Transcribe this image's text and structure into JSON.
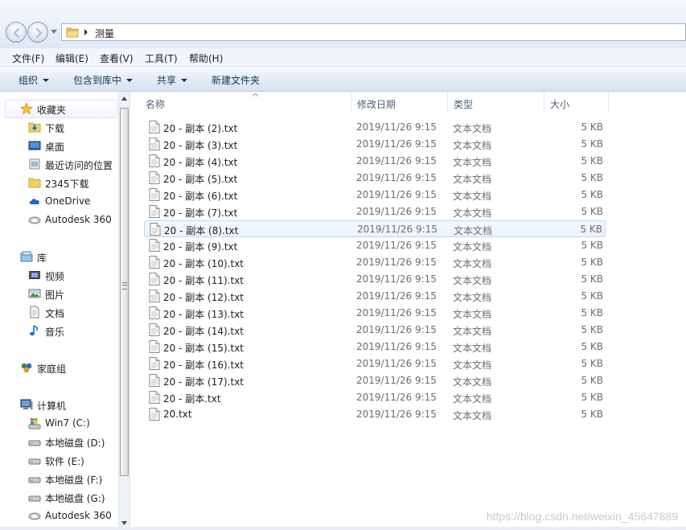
{
  "address": {
    "path": "测量"
  },
  "menu": [
    "文件(F)",
    "编辑(E)",
    "查看(V)",
    "工具(T)",
    "帮助(H)"
  ],
  "toolbar": {
    "organize": "组织",
    "include_in_library": "包含到库中",
    "share": "共享",
    "new_folder": "新建文件夹"
  },
  "nav": {
    "favorites": {
      "label": "收藏夹",
      "items": [
        "下载",
        "桌面",
        "最近访问的位置",
        "2345下载",
        "OneDrive",
        "Autodesk 360"
      ]
    },
    "libraries": {
      "label": "库",
      "items": [
        "视频",
        "图片",
        "文档",
        "音乐"
      ]
    },
    "homegroup": {
      "label": "家庭组"
    },
    "computer": {
      "label": "计算机",
      "items": [
        "Win7 (C:)",
        "本地磁盘 (D:)",
        "软件 (E:)",
        "本地磁盘 (F:)",
        "本地磁盘 (G:)",
        "Autodesk 360"
      ]
    }
  },
  "columns": {
    "name": "名称",
    "date": "修改日期",
    "type": "类型",
    "size": "大小"
  },
  "files": [
    {
      "name": "20 - 副本 (2).txt",
      "date": "2019/11/26 9:15",
      "type": "文本文档",
      "size": "5 KB"
    },
    {
      "name": "20 - 副本 (3).txt",
      "date": "2019/11/26 9:15",
      "type": "文本文档",
      "size": "5 KB"
    },
    {
      "name": "20 - 副本 (4).txt",
      "date": "2019/11/26 9:15",
      "type": "文本文档",
      "size": "5 KB"
    },
    {
      "name": "20 - 副本 (5).txt",
      "date": "2019/11/26 9:15",
      "type": "文本文档",
      "size": "5 KB"
    },
    {
      "name": "20 - 副本 (6).txt",
      "date": "2019/11/26 9:15",
      "type": "文本文档",
      "size": "5 KB"
    },
    {
      "name": "20 - 副本 (7).txt",
      "date": "2019/11/26 9:15",
      "type": "文本文档",
      "size": "5 KB"
    },
    {
      "name": "20 - 副本 (8).txt",
      "date": "2019/11/26 9:15",
      "type": "文本文档",
      "size": "5 KB"
    },
    {
      "name": "20 - 副本 (9).txt",
      "date": "2019/11/26 9:15",
      "type": "文本文档",
      "size": "5 KB"
    },
    {
      "name": "20 - 副本 (10).txt",
      "date": "2019/11/26 9:15",
      "type": "文本文档",
      "size": "5 KB"
    },
    {
      "name": "20 - 副本 (11).txt",
      "date": "2019/11/26 9:15",
      "type": "文本文档",
      "size": "5 KB"
    },
    {
      "name": "20 - 副本 (12).txt",
      "date": "2019/11/26 9:15",
      "type": "文本文档",
      "size": "5 KB"
    },
    {
      "name": "20 - 副本 (13).txt",
      "date": "2019/11/26 9:15",
      "type": "文本文档",
      "size": "5 KB"
    },
    {
      "name": "20 - 副本 (14).txt",
      "date": "2019/11/26 9:15",
      "type": "文本文档",
      "size": "5 KB"
    },
    {
      "name": "20 - 副本 (15).txt",
      "date": "2019/11/26 9:15",
      "type": "文本文档",
      "size": "5 KB"
    },
    {
      "name": "20 - 副本 (16).txt",
      "date": "2019/11/26 9:15",
      "type": "文本文档",
      "size": "5 KB"
    },
    {
      "name": "20 - 副本 (17).txt",
      "date": "2019/11/26 9:15",
      "type": "文本文档",
      "size": "5 KB"
    },
    {
      "name": "20 - 副本.txt",
      "date": "2019/11/26 9:15",
      "type": "文本文档",
      "size": "5 KB"
    },
    {
      "name": "20.txt",
      "date": "2019/11/26 9:15",
      "type": "文本文档",
      "size": "5 KB"
    }
  ],
  "hovered_row": 6,
  "watermark": "https://blog.csdn.net/weixin_45647889"
}
